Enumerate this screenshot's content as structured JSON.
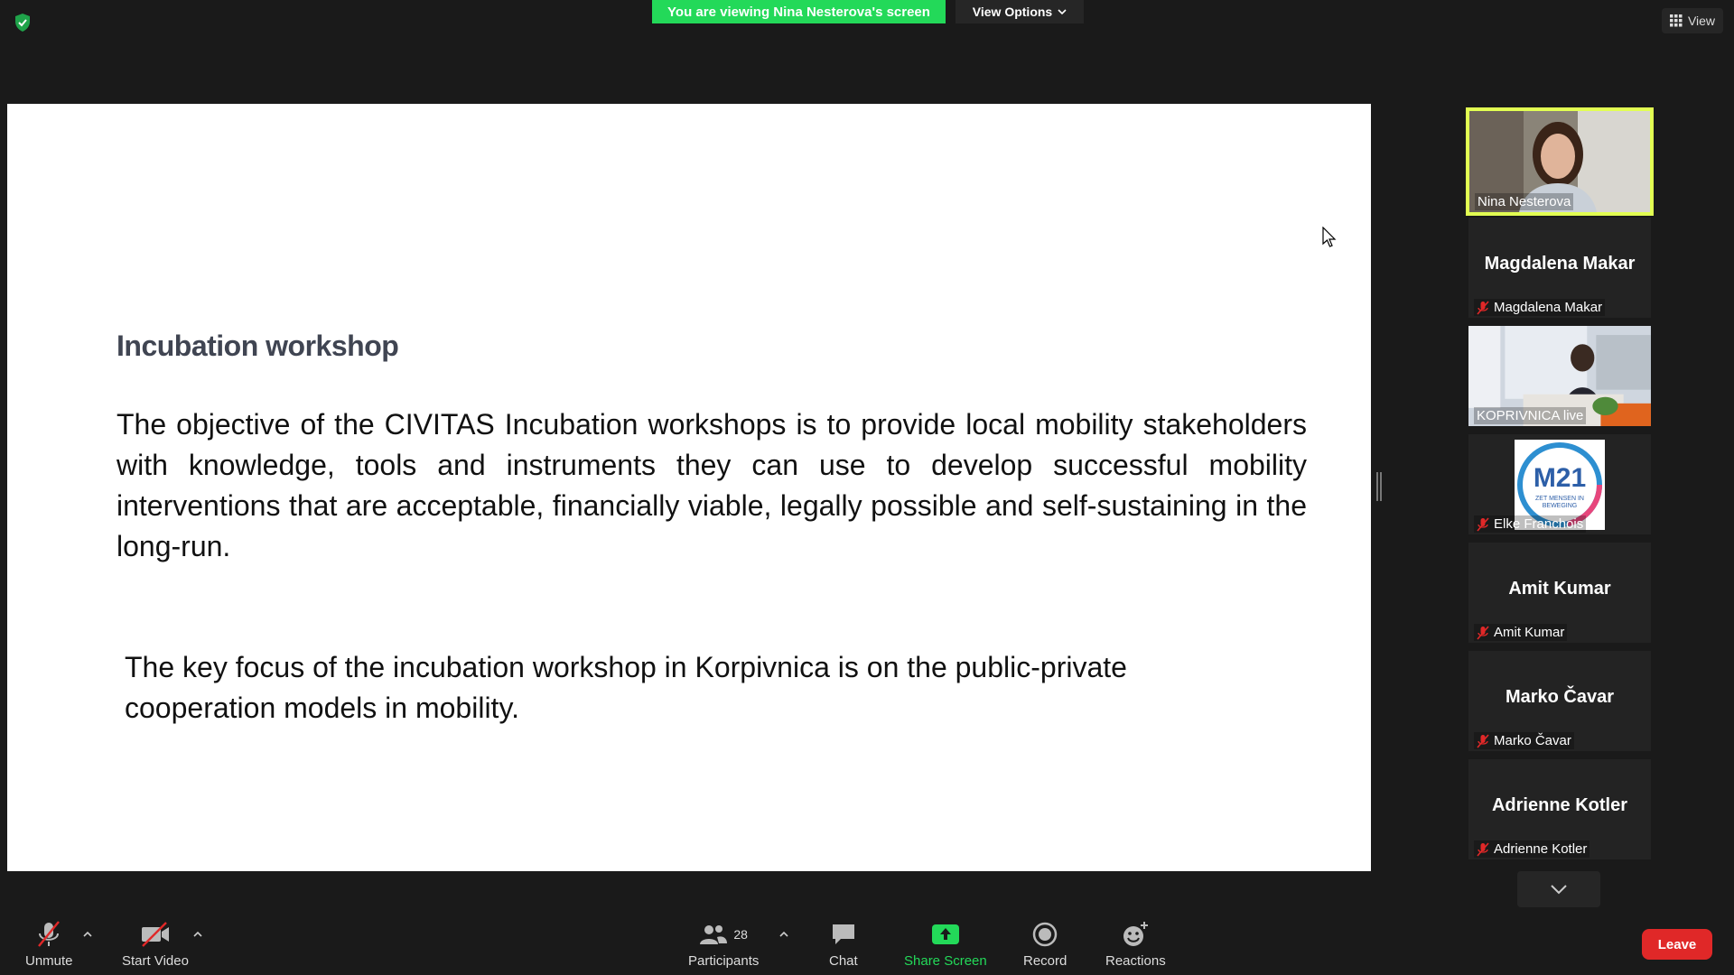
{
  "top": {
    "viewing_banner": "You are viewing Nina Nesterova's screen",
    "view_options": "View Options",
    "view_label": "View"
  },
  "slide": {
    "title": "Incubation workshop",
    "paragraph1": "The objective of the CIVITAS Incubation workshops is to provide local mobility stakeholders with knowledge, tools and instruments they can use to develop successful mobility interventions that are acceptable, financially viable, legally possible and self-sustaining in the long-run.",
    "paragraph2": "The key focus of the incubation workshop in Korpivnica is on the public-private cooperation models in mobility."
  },
  "participants": [
    {
      "label": "Nina Nesterova",
      "big_name": "",
      "muted": false,
      "type": "video-woman"
    },
    {
      "label": "Magdalena Makar",
      "big_name": "Magdalena Makar",
      "muted": true,
      "type": "name"
    },
    {
      "label": "KOPRIVNICA live",
      "big_name": "",
      "muted": false,
      "type": "video-room"
    },
    {
      "label": "Elke Franchois",
      "big_name": "",
      "muted": true,
      "type": "logo",
      "logo_text": "M21",
      "logo_sub": "ZET MENSEN IN BEWEGING"
    },
    {
      "label": "Amit Kumar",
      "big_name": "Amit Kumar",
      "muted": true,
      "type": "name"
    },
    {
      "label": "Marko Čavar",
      "big_name": "Marko Čavar",
      "muted": true,
      "type": "name"
    },
    {
      "label": "Adrienne Kotler",
      "big_name": "Adrienne Kotler",
      "muted": true,
      "type": "name"
    }
  ],
  "toolbar": {
    "unmute": "Unmute",
    "start_video": "Start Video",
    "participants": "Participants",
    "participant_count": "28",
    "chat": "Chat",
    "share_screen": "Share Screen",
    "record": "Record",
    "reactions": "Reactions",
    "leave": "Leave"
  },
  "colors": {
    "banner_green": "#23d959",
    "active_speaker": "#e2ff52",
    "leave_red": "#e02828",
    "muted_red": "#e02828"
  }
}
